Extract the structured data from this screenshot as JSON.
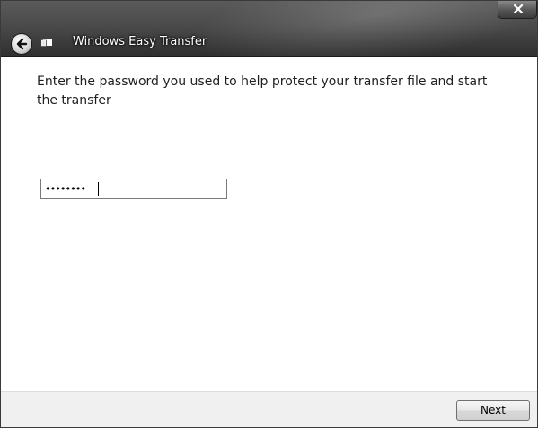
{
  "window": {
    "title": "Windows Easy Transfer",
    "close_label": "x"
  },
  "main": {
    "instruction": "Enter the password you used to help protect your transfer file and start the transfer",
    "password_field": {
      "masked_value": "••••••••"
    }
  },
  "footer": {
    "next_mnemonic": "N",
    "next_rest": "ext"
  },
  "icons": {
    "back": "back-arrow-icon",
    "app": "windows-easy-transfer-icon",
    "close": "close-icon"
  }
}
